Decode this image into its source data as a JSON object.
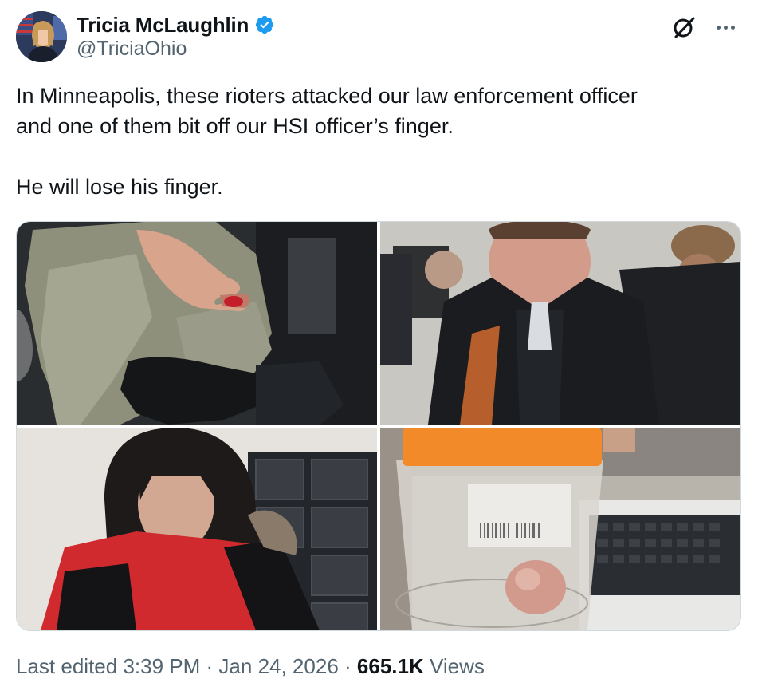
{
  "author": {
    "display_name": "Tricia McLaughlin",
    "handle": "@TriciaOhio",
    "verified_icon": "verified-badge-icon",
    "avatar_icon": "avatar"
  },
  "actions": {
    "grok_icon": "grok-icon",
    "more_icon": "more-options-icon"
  },
  "tweet": {
    "line1": "In Minneapolis, these rioters attacked our law enforcement officer",
    "line2": "and one of them bit off our HSI officer’s finger.",
    "line3": "He will lose his finger."
  },
  "media": {
    "count": 4
  },
  "meta": {
    "edited_label": "Last edited",
    "time": "3:39 PM",
    "separator1": "·",
    "date": "Jan 24, 2026",
    "separator2": "·",
    "views_count": "665.1K",
    "views_label": "Views"
  },
  "colors": {
    "text_primary": "#0f1419",
    "text_secondary": "#536471",
    "verified_blue": "#1d9bf0",
    "border": "#cfd9de"
  }
}
